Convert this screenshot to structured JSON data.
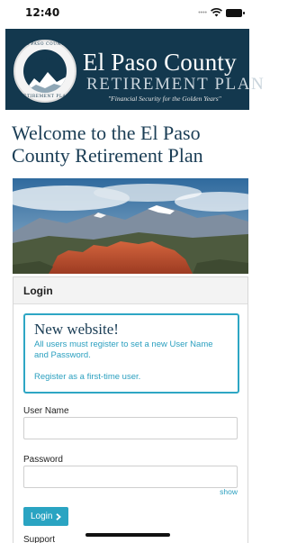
{
  "status_bar": {
    "time": "12:40",
    "signal_icon": "signal-dots-icon",
    "wifi_icon": "wifi-icon",
    "battery_icon": "battery-icon"
  },
  "banner": {
    "background_color": "#13384e",
    "seal": {
      "top_text": "EL PASO COUNTY",
      "est_text": "EST. 1967",
      "bottom_text": "RETIREMENT PLAN"
    },
    "brand_name": "El Paso County",
    "brand_sub": "RETIREMENT PLAN",
    "tagline": "\"Financial Security for the Golden Years\""
  },
  "welcome_heading": "Welcome to the El Paso County Retirement Plan",
  "login": {
    "title": "Login",
    "notice": {
      "title": "New website!",
      "text": "All users must register to set a new User Name and Password.",
      "link": "Register as a first-time user.",
      "accent_color": "#2ea6c4"
    },
    "username_label": "User Name",
    "username_value": "",
    "password_label": "Password",
    "password_value": "",
    "show_link": "show",
    "login_button": "Login",
    "login_button_icon": "chevron-right-icon",
    "support_label": "Support"
  }
}
